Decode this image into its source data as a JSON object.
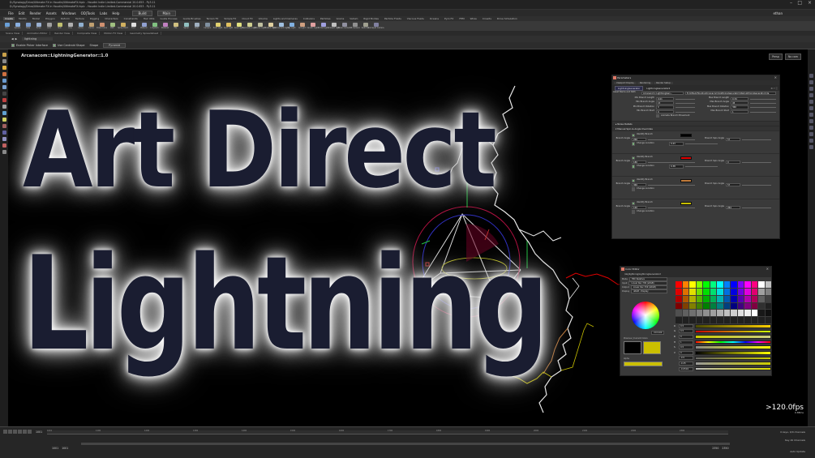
{
  "window": {
    "title_line1": "D:/Synology/Drive/Ultimate FX in Houdini/UltimateFX.hiplc - Houdini Indie Limited-Commercial 20.0.653 - Py3.11",
    "title_line2": "D:/Synology/Drive/Ultimate FX in Houdini/UltimateFX.hiplc - Houdini Indie Limited-Commercial 20.0.653 - Py3.11"
  },
  "menubar": {
    "items": [
      "File",
      "Edit",
      "Render",
      "Assets",
      "Windows",
      "OD|Tools",
      "Labs",
      "Help"
    ],
    "desktop": "Build",
    "network": "Main",
    "user": "ethan"
  },
  "shelf_tabs": [
    "Create",
    "Modify",
    "Model",
    "Polygon",
    "Deform",
    "Texture",
    "Rigging",
    "Characters",
    "Constraints",
    "Hair Utils",
    "Guide Process",
    "Guide Brushes",
    "Terrain FX",
    "Simple FX",
    "Cloud FX",
    "Volume",
    "Lights and Cameras",
    "Collisions",
    "Particles",
    "Grains",
    "Vellum",
    "Rigid Bodies",
    "Particle Fluids",
    "Viscous Fluids",
    "Oceans",
    "Pyro FX",
    "FEM",
    "Wires",
    "Crowds",
    "Drive Simulation"
  ],
  "shelf_tools": [
    {
      "label": "Box",
      "color": "#6aa0d8"
    },
    {
      "label": "Sphere",
      "color": "#8ab0e0"
    },
    {
      "label": "Tube",
      "color": "#7a9ac8"
    },
    {
      "label": "Torus",
      "color": "#9ab0d0"
    },
    {
      "label": "Grid",
      "color": "#a0a0a0"
    },
    {
      "label": "Null",
      "color": "#c0c070"
    },
    {
      "label": "Line",
      "color": "#b0b0b0"
    },
    {
      "label": "Circle",
      "color": "#90b0d0"
    },
    {
      "label": "Curve",
      "color": "#c0a070"
    },
    {
      "label": "Draw Curve",
      "color": "#d09070"
    },
    {
      "label": "Path",
      "color": "#a0c080"
    },
    {
      "label": "Spray Paint",
      "color": "#d0b060"
    },
    {
      "label": "Font",
      "color": "#e0e0e0"
    },
    {
      "label": "Platonic",
      "color": "#90a0d0"
    },
    {
      "label": "L-System",
      "color": "#80c080"
    },
    {
      "label": "Metaball",
      "color": "#c080c0"
    },
    {
      "label": "File",
      "color": "#d0c080"
    },
    {
      "label": "Spiral",
      "color": "#90c0c0"
    },
    {
      "label": "Helix",
      "color": "#a0b0c0"
    },
    {
      "label": "Camera",
      "color": "#8090a0"
    },
    {
      "label": "Point Light",
      "color": "#e0d070"
    },
    {
      "label": "Spot Light",
      "color": "#e0c060"
    },
    {
      "label": "Area Light",
      "color": "#e0e080"
    },
    {
      "label": "Geometry Light",
      "color": "#d0d090"
    },
    {
      "label": "Volume Light",
      "color": "#c0c0a0"
    },
    {
      "label": "Distant Light",
      "color": "#e0d0a0"
    },
    {
      "label": "Environment Light",
      "color": "#a0c0e0"
    },
    {
      "label": "Sky Light",
      "color": "#80b0e0"
    },
    {
      "label": "GI Light",
      "color": "#d0a080"
    },
    {
      "label": "Caustic Light",
      "color": "#e0a0a0"
    },
    {
      "label": "Portal Light",
      "color": "#a0a0e0"
    },
    {
      "label": "Ambient Light",
      "color": "#c0c0c0"
    },
    {
      "label": "Stereo Camera",
      "color": "#9090a0"
    },
    {
      "label": "VR Camera",
      "color": "#909090"
    },
    {
      "label": "Switcher",
      "color": "#a0a090"
    },
    {
      "label": "Gamepad Camera",
      "color": "#8080a0"
    }
  ],
  "pane_tabs": [
    "Scene View",
    "Animation Editor",
    "Render View",
    "Composite View",
    "Motion FX View",
    "Geometry Spreadsheet"
  ],
  "viewer": {
    "path": "lightning",
    "enable_picker_label": "Enable Picker Interface",
    "use_centroid_label": "Use Centroid Shape",
    "shape_label": "Shape",
    "shape_value": "Pyramid",
    "node_label": "Arcanacom::LightningGenerator::1.0",
    "persp": "Persp",
    "cam": "No cam",
    "fps": ">120.0fps",
    "fps_sub": "0.88ms"
  },
  "thumbnail": {
    "line1": "Art Direct",
    "line2": "Lightning"
  },
  "parameters": {
    "title": "Parameters",
    "tabs": [
      "Viewport Display",
      "Rendering",
      "Render Setup"
    ],
    "node_type": "LightningGenerator",
    "node_name": "LightningGenerator2",
    "asset_label": "Asset Name and Path",
    "asset_name": "Arcanacom::LightningGen...",
    "asset_path": "E:/github/Houdini/Arcanacom/LightningGenerator/otls/LightningGenerator.hda",
    "rows": [
      {
        "l1": "Min Branch Length",
        "v1": "0.01",
        "l2": "Max Branch Length",
        "v2": "0.34"
      },
      {
        "l1": "Min Branch Angle",
        "v1": "15",
        "l2": "Max Branch Angle",
        "v2": "45"
      },
      {
        "l1": "Min Branch Rotation",
        "v1": "0",
        "l2": "Max Branch Rotation",
        "v2": "360"
      },
      {
        "l1": "Min Branch Start",
        "v1": "0",
        "l2": "Max Branch Start",
        "v2": "1"
      }
    ],
    "animate_label": "Animate Branch Movement",
    "noise_section": "Noise Details",
    "manual_section": "Manual Spin & Angle Overrides",
    "overrides": [
      {
        "identify": "Identify Branch",
        "color": "#000000",
        "angle_label": "Branch Angle",
        "angle": "266",
        "spin_label": "Branch Spin Angle",
        "spin": "57",
        "change_label": "Change Location",
        "location": "0.43",
        "change_on": true
      },
      {
        "identify": "Identify Branch",
        "color": "#e00000",
        "angle_label": "Branch Angle",
        "angle": "180",
        "spin_label": "Branch Spin Angle",
        "spin": "0",
        "change_label": "Change Location",
        "location": "0.38",
        "change_on": true
      },
      {
        "identify": "Identify Branch",
        "color": "#c07a3a",
        "angle_label": "Branch Angle",
        "angle": "360",
        "spin_label": "Branch Spin Angle",
        "spin": "57",
        "change_label": "Change Location",
        "location": "",
        "change_on": false
      },
      {
        "identify": "Identify Branch",
        "color": "#c8bf00",
        "angle_label": "Branch Angle",
        "angle": "160",
        "spin_label": "Branch Spin Angle",
        "spin": "264",
        "change_label": "Change Location",
        "location": "",
        "change_on": false
      }
    ]
  },
  "color_editor": {
    "title": "Color Editor",
    "target": "/obj/lightning/LightningGenerator2",
    "mode_label": "Mode",
    "mode_value": "HSV Relative",
    "input_label": "Input",
    "input_value": "Linear Rec.709 (sRGB)",
    "output_label": "Output",
    "output_value": "Linear Rec.709 (sRGB)",
    "display_label": "Display",
    "display_value": "sRGB - Display",
    "hex": "CCC100",
    "prev_current_label": "Previous | Current Colors",
    "alpha_label": "Alpha",
    "palette": [
      "#ff0000",
      "#ff8000",
      "#ffff00",
      "#80ff00",
      "#00ff00",
      "#00ff80",
      "#00ffff",
      "#0080ff",
      "#0000ff",
      "#8000ff",
      "#ff00ff",
      "#ff0080",
      "#ffffff",
      "#c0c0c0",
      "#e00000",
      "#e07000",
      "#e0e000",
      "#70e000",
      "#00e000",
      "#00e070",
      "#00e0e0",
      "#0070e0",
      "#0000e0",
      "#7000e0",
      "#e000e0",
      "#e00070",
      "#a0a0a0",
      "#808080",
      "#b00000",
      "#b05800",
      "#b0b000",
      "#58b000",
      "#00b000",
      "#00b058",
      "#00b0b0",
      "#0058b0",
      "#0000b0",
      "#5800b0",
      "#b000b0",
      "#b00058",
      "#606060",
      "#404040",
      "#800000",
      "#804000",
      "#808000",
      "#408000",
      "#008000",
      "#008040",
      "#008080",
      "#004080",
      "#000080",
      "#400080",
      "#800080",
      "#800040",
      "#303030",
      "#202020",
      "#505050",
      "#606060",
      "#707070",
      "#808080",
      "#909090",
      "#a0a0a0",
      "#b0b0b0",
      "#c0c0c0",
      "#d0d0d0",
      "#e0e0e0",
      "#f0f0f0",
      "#ffffff",
      "#181818",
      "#101010",
      "#202020",
      "#202020",
      "#202020",
      "#202020",
      "#202020",
      "#202020",
      "#202020",
      "#202020",
      "#202020",
      "#202020",
      "#202020",
      "#202020",
      "#202020",
      "#202020"
    ],
    "sliders": [
      {
        "label": "R",
        "value": "0.5",
        "gradient": "linear-gradient(90deg,#4a4a00,#ffd000)"
      },
      {
        "label": "G",
        "value": "0.5",
        "gradient": "linear-gradient(90deg,#cc0000,#ccff00)"
      },
      {
        "label": "B",
        "value": "0",
        "gradient": "linear-gradient(90deg,#cccc00,#cccc80)"
      },
      {
        "label": "H",
        "value": "1",
        "gradient": "linear-gradient(90deg,#f00,#ff0,#0f0,#0ff,#00f,#f0f,#f00)"
      },
      {
        "label": "S",
        "value": "0.5",
        "gradient": "linear-gradient(90deg,#888,#ff0)"
      },
      {
        "label": "V",
        "value": "0",
        "gradient": "linear-gradient(90deg,#000,#ff0)"
      },
      {
        "label": "",
        "value": "-0.5",
        "gradient": "linear-gradient(90deg,#666,#cc0)"
      },
      {
        "label": "",
        "value": "-0.25",
        "gradient": "linear-gradient(90deg,#999,#cc0)"
      },
      {
        "label": "",
        "value": "-0.0504",
        "gradient": "linear-gradient(90deg,#bbb,#dd0)"
      }
    ]
  },
  "timeline": {
    "frame": "1001",
    "start": "1001",
    "end": "2350",
    "start2": "1001",
    "end2": "2350",
    "range_end": "2350",
    "ticks": [
      "1001",
      "1100",
      "1200",
      "1300",
      "1400",
      "1500",
      "1600",
      "1700",
      "1800",
      "1900",
      "2000",
      "2100",
      "2200",
      "2300"
    ],
    "keys_status": "0 keys, 0/0 channels",
    "key_all": "Key All Channels",
    "auto_update": "Auto Update"
  }
}
